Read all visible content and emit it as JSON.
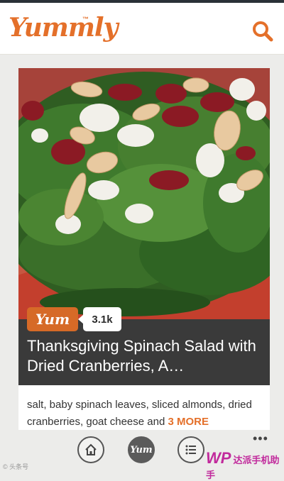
{
  "app": {
    "logo_text": "Yummly",
    "logo_mark": "™"
  },
  "header": {
    "search_icon": "search-icon"
  },
  "recipe": {
    "yum_label": "Yum",
    "yum_count": "3.1k",
    "title": "Thanksgiving Spinach Salad with Dried Cranberries, A…",
    "ingredients": "salt, baby spinach leaves, sliced almonds, dried cranberries, goat cheese and ",
    "more_label": "3 MORE"
  },
  "bottom_bar": {
    "items": [
      {
        "name": "home-icon"
      },
      {
        "name": "yum-icon",
        "label": "Yum"
      },
      {
        "name": "list-icon"
      }
    ],
    "more_label": "•••"
  },
  "watermarks": {
    "left": "©  头条号",
    "right_logo": "WP",
    "right_text": "达派手机助手"
  },
  "colors": {
    "accent": "#e4702a",
    "title_bg": "#3a3a3a",
    "yum_badge": "#d66a27"
  }
}
